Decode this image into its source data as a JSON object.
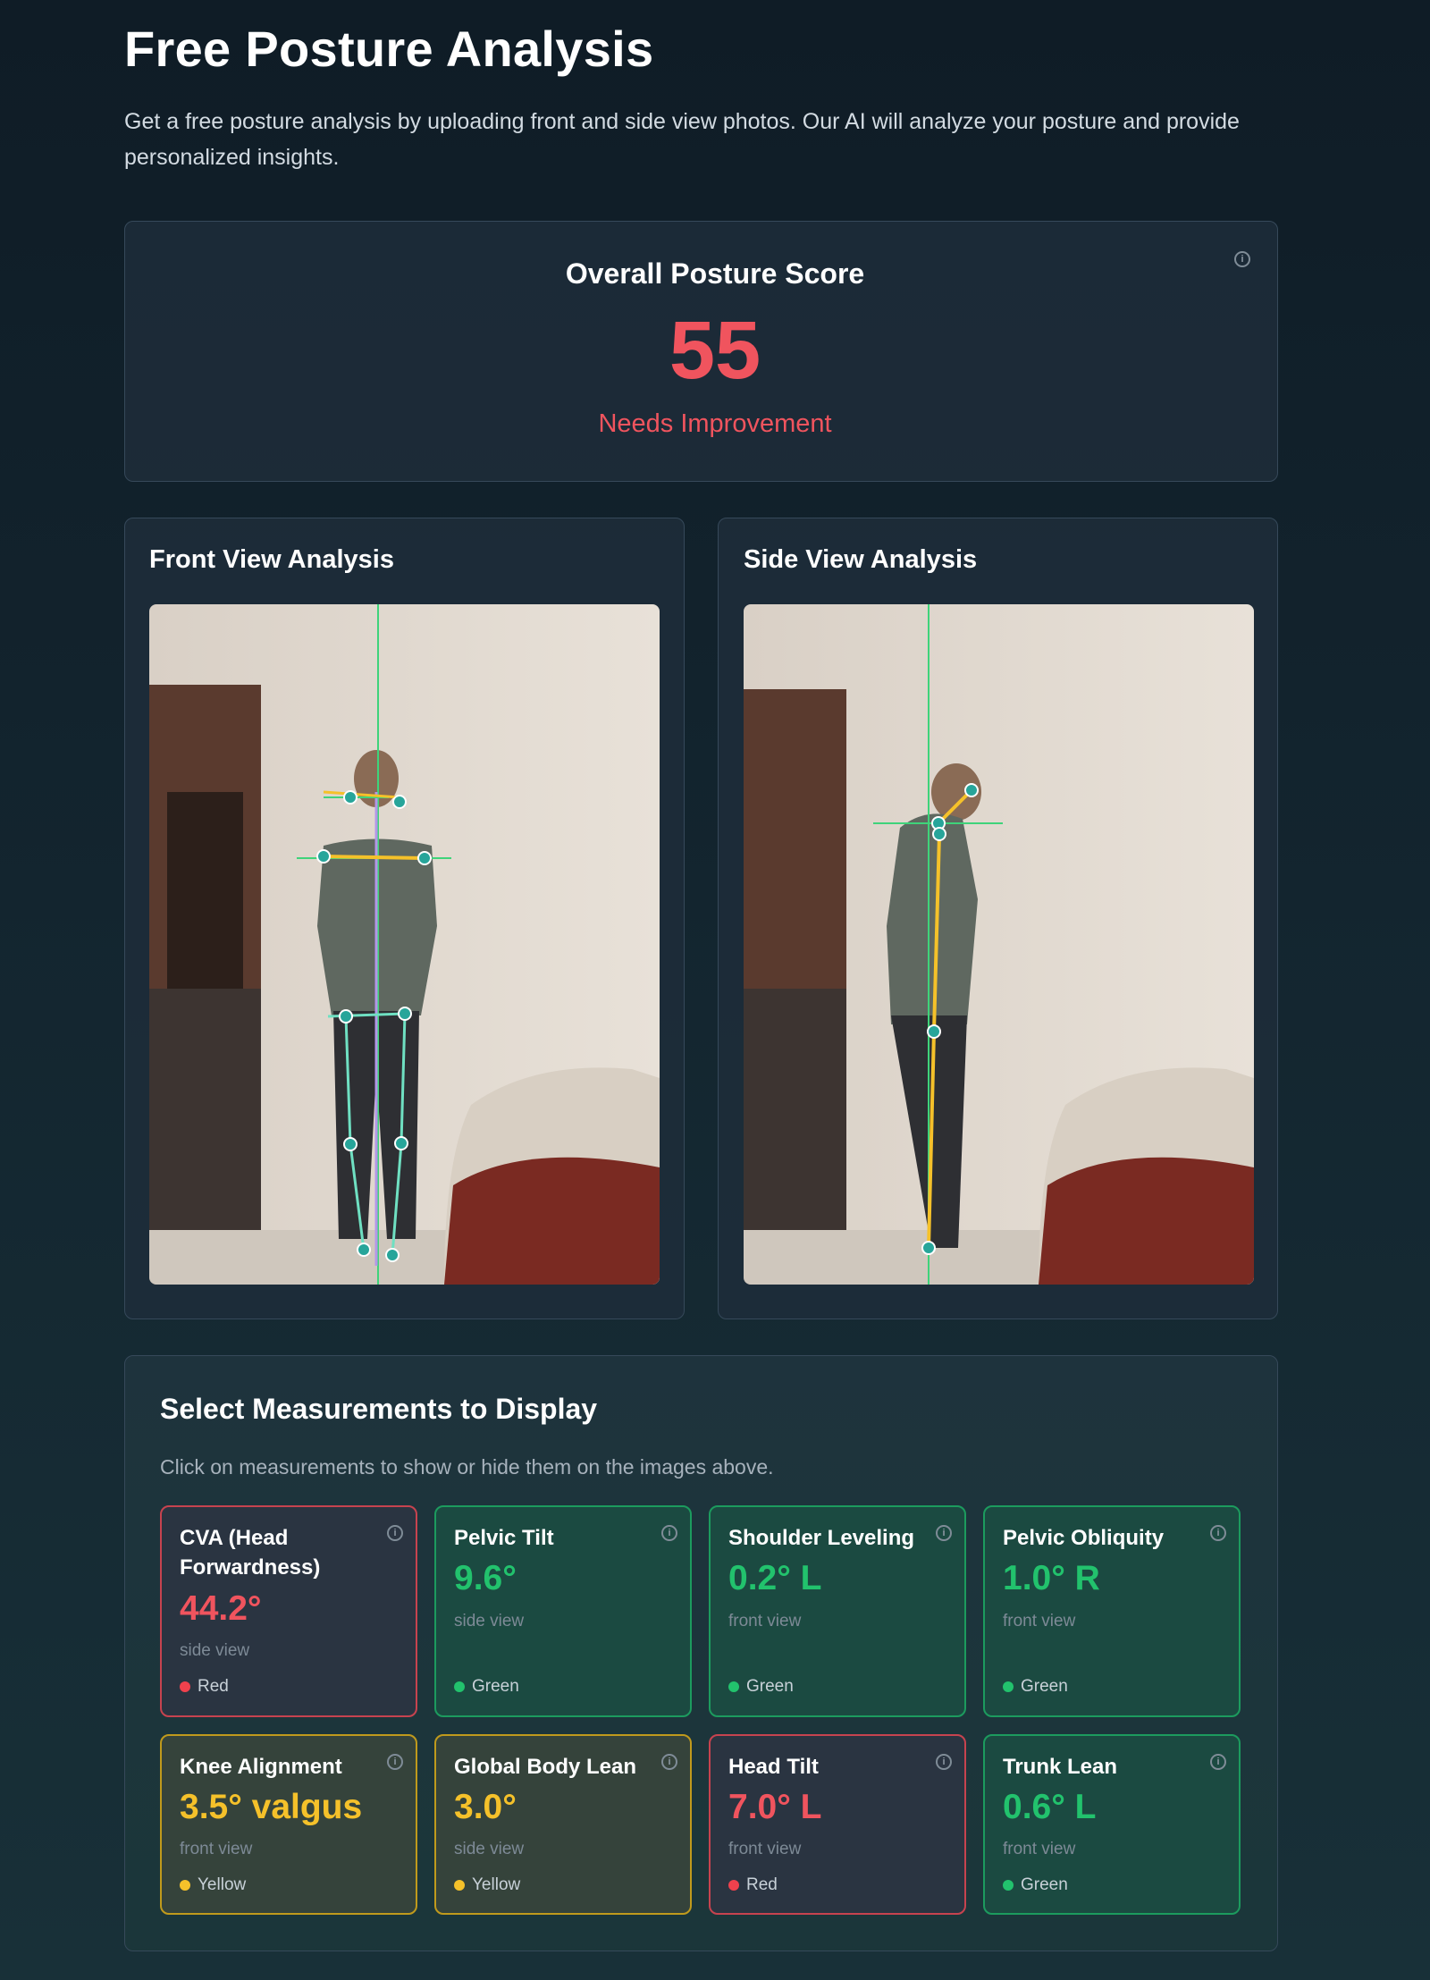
{
  "page": {
    "title": "Free Posture Analysis",
    "subtitle": "Get a free posture analysis by uploading front and side view photos. Our AI will analyze your posture and provide personalized insights."
  },
  "score": {
    "title": "Overall Posture Score",
    "value": "55",
    "status": "Needs Improvement",
    "color": "#f0545e"
  },
  "views": {
    "front_title": "Front View Analysis",
    "side_title": "Side View Analysis"
  },
  "measurements": {
    "title": "Select Measurements to Display",
    "hint": "Click on measurements to show or hide them on the images above.",
    "items": [
      {
        "name": "CVA (Head Forwardness)",
        "value": "44.2°",
        "view": "side view",
        "status": "Red"
      },
      {
        "name": "Pelvic Tilt",
        "value": "9.6°",
        "view": "side view",
        "status": "Green"
      },
      {
        "name": "Shoulder Leveling",
        "value": "0.2° L",
        "view": "front view",
        "status": "Green"
      },
      {
        "name": "Pelvic Obliquity",
        "value": "1.0° R",
        "view": "front view",
        "status": "Green"
      },
      {
        "name": "Knee Alignment",
        "value": "3.5° valgus",
        "view": "front view",
        "status": "Yellow"
      },
      {
        "name": "Global Body Lean",
        "value": "3.0°",
        "view": "side view",
        "status": "Yellow"
      },
      {
        "name": "Head Tilt",
        "value": "7.0° L",
        "view": "front view",
        "status": "Red"
      },
      {
        "name": "Trunk Lean",
        "value": "0.6° L",
        "view": "front view",
        "status": "Green"
      }
    ]
  },
  "colors": {
    "red": "#f0545e",
    "green": "#22c26d",
    "yellow": "#f5c12a",
    "landmark": "#27a59a",
    "plumb_line": "#3fd37a",
    "front_segment": "#f5c12a",
    "leg_segment": "#6fe0c2",
    "midline": "#b496e8"
  }
}
